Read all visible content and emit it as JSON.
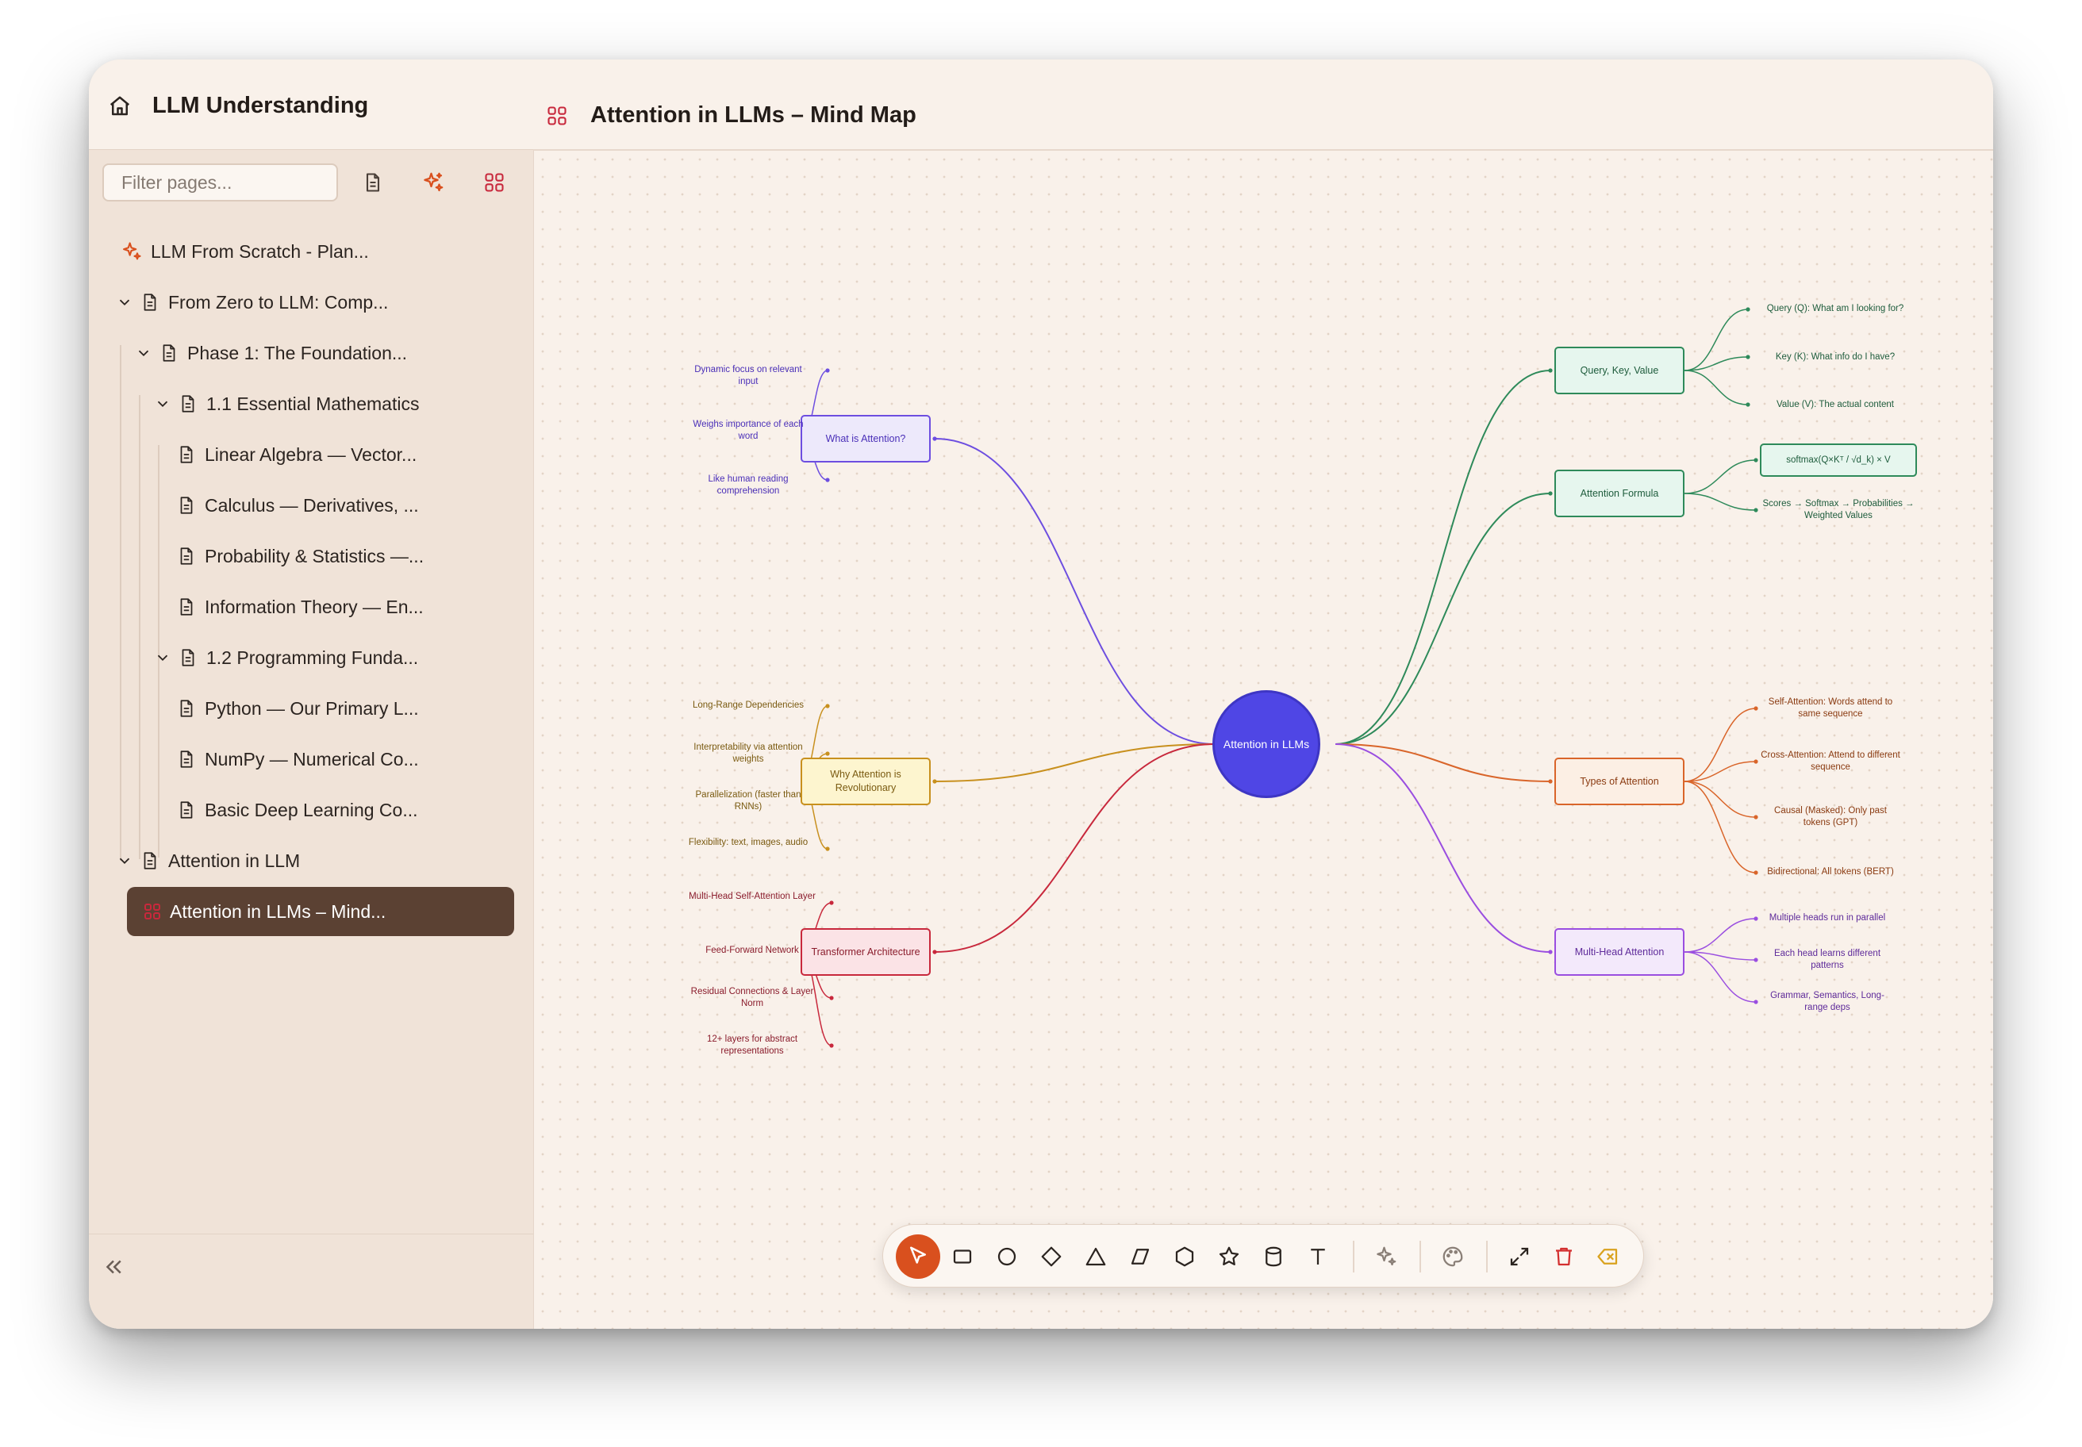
{
  "sidebar": {
    "title": "LLM Understanding",
    "filter_placeholder": "Filter pages...",
    "items": [
      {
        "label": "LLM From Scratch - Plan..."
      },
      {
        "label": "From Zero to LLM: Comp..."
      },
      {
        "label": "Phase 1: The Foundation..."
      },
      {
        "label": "1.1 Essential Mathematics"
      },
      {
        "label": "Linear Algebra — Vector..."
      },
      {
        "label": "Calculus — Derivatives, ..."
      },
      {
        "label": "Probability & Statistics —..."
      },
      {
        "label": "Information Theory — En..."
      },
      {
        "label": "1.2 Programming Funda..."
      },
      {
        "label": "Python — Our Primary L..."
      },
      {
        "label": "NumPy — Numerical Co..."
      },
      {
        "label": "Basic Deep Learning Co..."
      },
      {
        "label": "Attention in LLM"
      },
      {
        "label": "Attention in LLMs – Mind..."
      }
    ]
  },
  "main": {
    "title": "Attention in LLMs – Mind Map"
  },
  "mindmap": {
    "center": "Attention in LLMs",
    "branches": {
      "what": {
        "label": "What is Attention?",
        "color": "#6d4ee0",
        "leaves": [
          "Dynamic focus on relevant input",
          "Weighs importance of each word",
          "Like human reading comprehension"
        ]
      },
      "why": {
        "label": "Why Attention is Revolutionary",
        "color": "#c8901e",
        "leaves": [
          "Long-Range Dependencies",
          "Interpretability via attention weights",
          "Parallelization (faster than RNNs)",
          "Flexibility: text, images, audio"
        ]
      },
      "transformer": {
        "label": "Transformer Architecture",
        "color": "#c8283c",
        "leaves": [
          "Multi-Head Self-Attention Layer",
          "Feed-Forward Network",
          "Residual Connections & Layer Norm",
          "12+ layers for abstract representations"
        ]
      },
      "qkv": {
        "label": "Query, Key, Value",
        "color": "#2e8a5a",
        "leaves": [
          "Query (Q): What am I looking for?",
          "Key (K): What info do I have?",
          "Value (V): The actual content"
        ]
      },
      "formula": {
        "label": "Attention Formula",
        "color": "#2e8a5a",
        "leaves": [
          "softmax(Q×Kᵀ / √d_k) × V",
          "Scores → Softmax → Probabilities → Weighted Values"
        ]
      },
      "types": {
        "label": "Types of Attention",
        "color": "#d9652a",
        "leaves": [
          "Self-Attention: Words attend to same sequence",
          "Cross-Attention: Attend to different sequence",
          "Causal (Masked): Only past tokens (GPT)",
          "Bidirectional: All tokens (BERT)"
        ]
      },
      "multihead": {
        "label": "Multi-Head Attention",
        "color": "#9a4ee0",
        "leaves": [
          "Multiple heads run in parallel",
          "Each head learns different patterns",
          "Grammar, Semantics, Long-range deps"
        ]
      }
    }
  },
  "toolbar": {
    "tools": [
      "select-tool",
      "rectangle-tool",
      "circle-tool",
      "diamond-tool",
      "triangle-tool",
      "parallelogram-tool",
      "hexagon-tool",
      "star-tool",
      "cylinder-tool",
      "text-tool",
      "ai-sparkle-tool",
      "palette-tool",
      "fit-view-tool",
      "delete-tool",
      "clear-tool"
    ],
    "accent": "#d9501e"
  }
}
